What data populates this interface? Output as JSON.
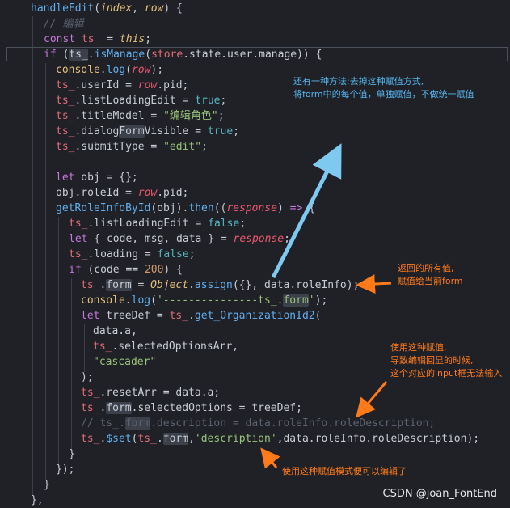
{
  "code_lines": [
    "handleEdit(index, row) {",
    "// 编辑",
    "const ts_ = this;",
    "if (ts_.isManage(store.state.user.manage)) {",
    "console.log(row);",
    "ts_.userId = row.pid;",
    "ts_.listLoadingEdit = true;",
    "ts_.titleModel = \"编辑角色\";",
    "ts_.dialogFormVisible = true;",
    "ts_.submitType = \"edit\";",
    "",
    "let obj = {};",
    "obj.roleId = row.pid;",
    "getRoleInfoById(obj).then((response) => {",
    "ts_.listLoadingEdit = false;",
    "let { code, msg, data } = response;",
    "ts_.loading = false;",
    "if (code == 200) {",
    "ts_.form = Object.assign({}, data.roleInfo);",
    "console.log('---------------ts_.form');",
    "let treeDef = ts_.get_OrganizationId2(",
    "data.a,",
    "ts_.selectedOptionsArr,",
    "\"cascader\"",
    ");",
    "ts_.resetArr = data.a;",
    "ts_.form.selectedOptions = treeDef;",
    "// ts_.form.description = data.roleInfo.roleDescription;",
    "ts_.$set(ts_.form,'description',data.roleInfo.roleDescription);",
    "}",
    "});",
    "}",
    "},"
  ],
  "annotations": {
    "blue_note": "还有一种方法:去掉这种赋值方式,\n将form中的每个值，单独赋值，不做统一赋值",
    "note_assign": "返回的所有值,\n赋值给当前form",
    "note_problem": "使用这种赋值,\n导致编辑回显的时候,\n这个对应的input框无法输入",
    "note_fix": "使用这种赋值模式便可以编辑了"
  },
  "watermark": "CSDN @joan_FontEnd",
  "colors": {
    "background": "#1f2127",
    "blue_annotation": "#56b6ef",
    "orange_annotation": "#ff7a18"
  }
}
